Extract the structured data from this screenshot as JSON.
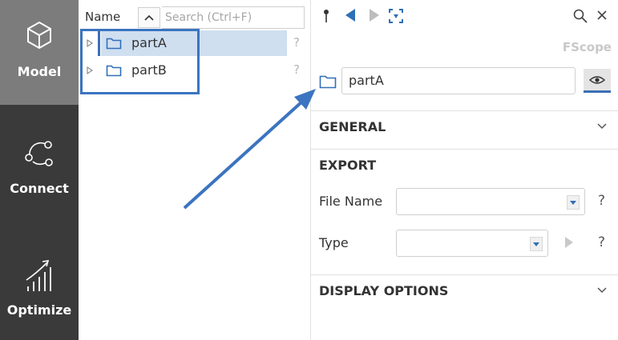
{
  "rail": {
    "items": [
      {
        "label": "Model",
        "icon": "cube-icon",
        "active": true
      },
      {
        "label": "Connect",
        "icon": "connect-nodes-icon",
        "active": false
      },
      {
        "label": "Optimize",
        "icon": "optimize-chart-icon",
        "active": false
      }
    ]
  },
  "tree": {
    "column_name": "Name",
    "search": {
      "placeholder": "Search (Ctrl+F)",
      "value": ""
    },
    "rows": [
      {
        "label": "partA",
        "help": "?",
        "selected": true
      },
      {
        "label": "partB",
        "help": "?",
        "selected": false
      }
    ]
  },
  "props": {
    "brand": "FScope",
    "name_value": "partA",
    "sections": {
      "general": "GENERAL",
      "export": "EXPORT",
      "display": "DISPLAY OPTIONS"
    },
    "fields": {
      "file_name_label": "File Name",
      "file_name_value": "",
      "type_label": "Type",
      "type_value": "",
      "help": "?"
    }
  },
  "colors": {
    "accent": "#3b6fb6",
    "annotation": "#3b74c0",
    "rail_bg": "#3a3a3a",
    "rail_active": "#7c7c7c",
    "selection": "#cfdff0"
  }
}
